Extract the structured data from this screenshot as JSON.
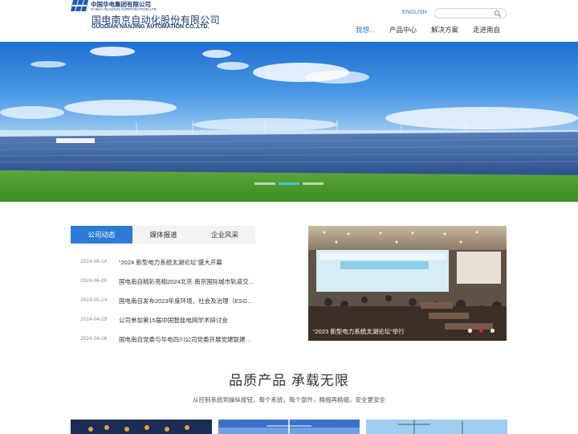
{
  "header": {
    "group_name_cn": "中国华电集团有限公司",
    "group_name_en": "CHINA HUADIAN CORPORATION LTD.",
    "company_name_cn": "国电南京自动化股份有限公司",
    "company_name_en": "GUODIAN NANJING AUTOMATION CO.,LTD.",
    "english_link": "ENGLISH",
    "search_placeholder": "",
    "nav": [
      {
        "label": "我想..."
      },
      {
        "label": "产品中心"
      },
      {
        "label": "解决方案"
      },
      {
        "label": "走进南自"
      }
    ]
  },
  "banner": {
    "image": "solar-farm-photo",
    "slide_count": 3,
    "active_slide": 2
  },
  "news": {
    "tabs": [
      "公司动态",
      "媒体报道",
      "企业风采"
    ],
    "active_tab": 0,
    "items": [
      {
        "date": "2024-08-14",
        "title": "“2024 新型电力系统太湖论坛”盛大开幕"
      },
      {
        "date": "2024-06-20",
        "title": "国电南自精彩亮相2024北京·南京国际城市轨道交通..."
      },
      {
        "date": "2024-05-14",
        "title": "国电南自发布2023年度环境，社会及治理（ESG）..."
      },
      {
        "date": "2024-04-29",
        "title": "公司参加第15届中国智能电网学术研讨会"
      },
      {
        "date": "2024-04-26",
        "title": "国电南自党委与华电四川公司党委开展党建联建共建..."
      }
    ]
  },
  "featured_photo": {
    "caption": "“2023 新型电力系统太湖论坛”举行",
    "slide_count": 3,
    "active_slide": 1
  },
  "products": {
    "title": "品质产品 承载无限",
    "subtitle": "从控制系统到操纵按钮，每个系统，每个部件，精细再精细，安全更安全"
  },
  "colors": {
    "accent": "#2b7bd9",
    "brand_navy": "#1a3a7a",
    "active_dot": "#49c0e0",
    "photo_dot_active": "#d9272e"
  }
}
